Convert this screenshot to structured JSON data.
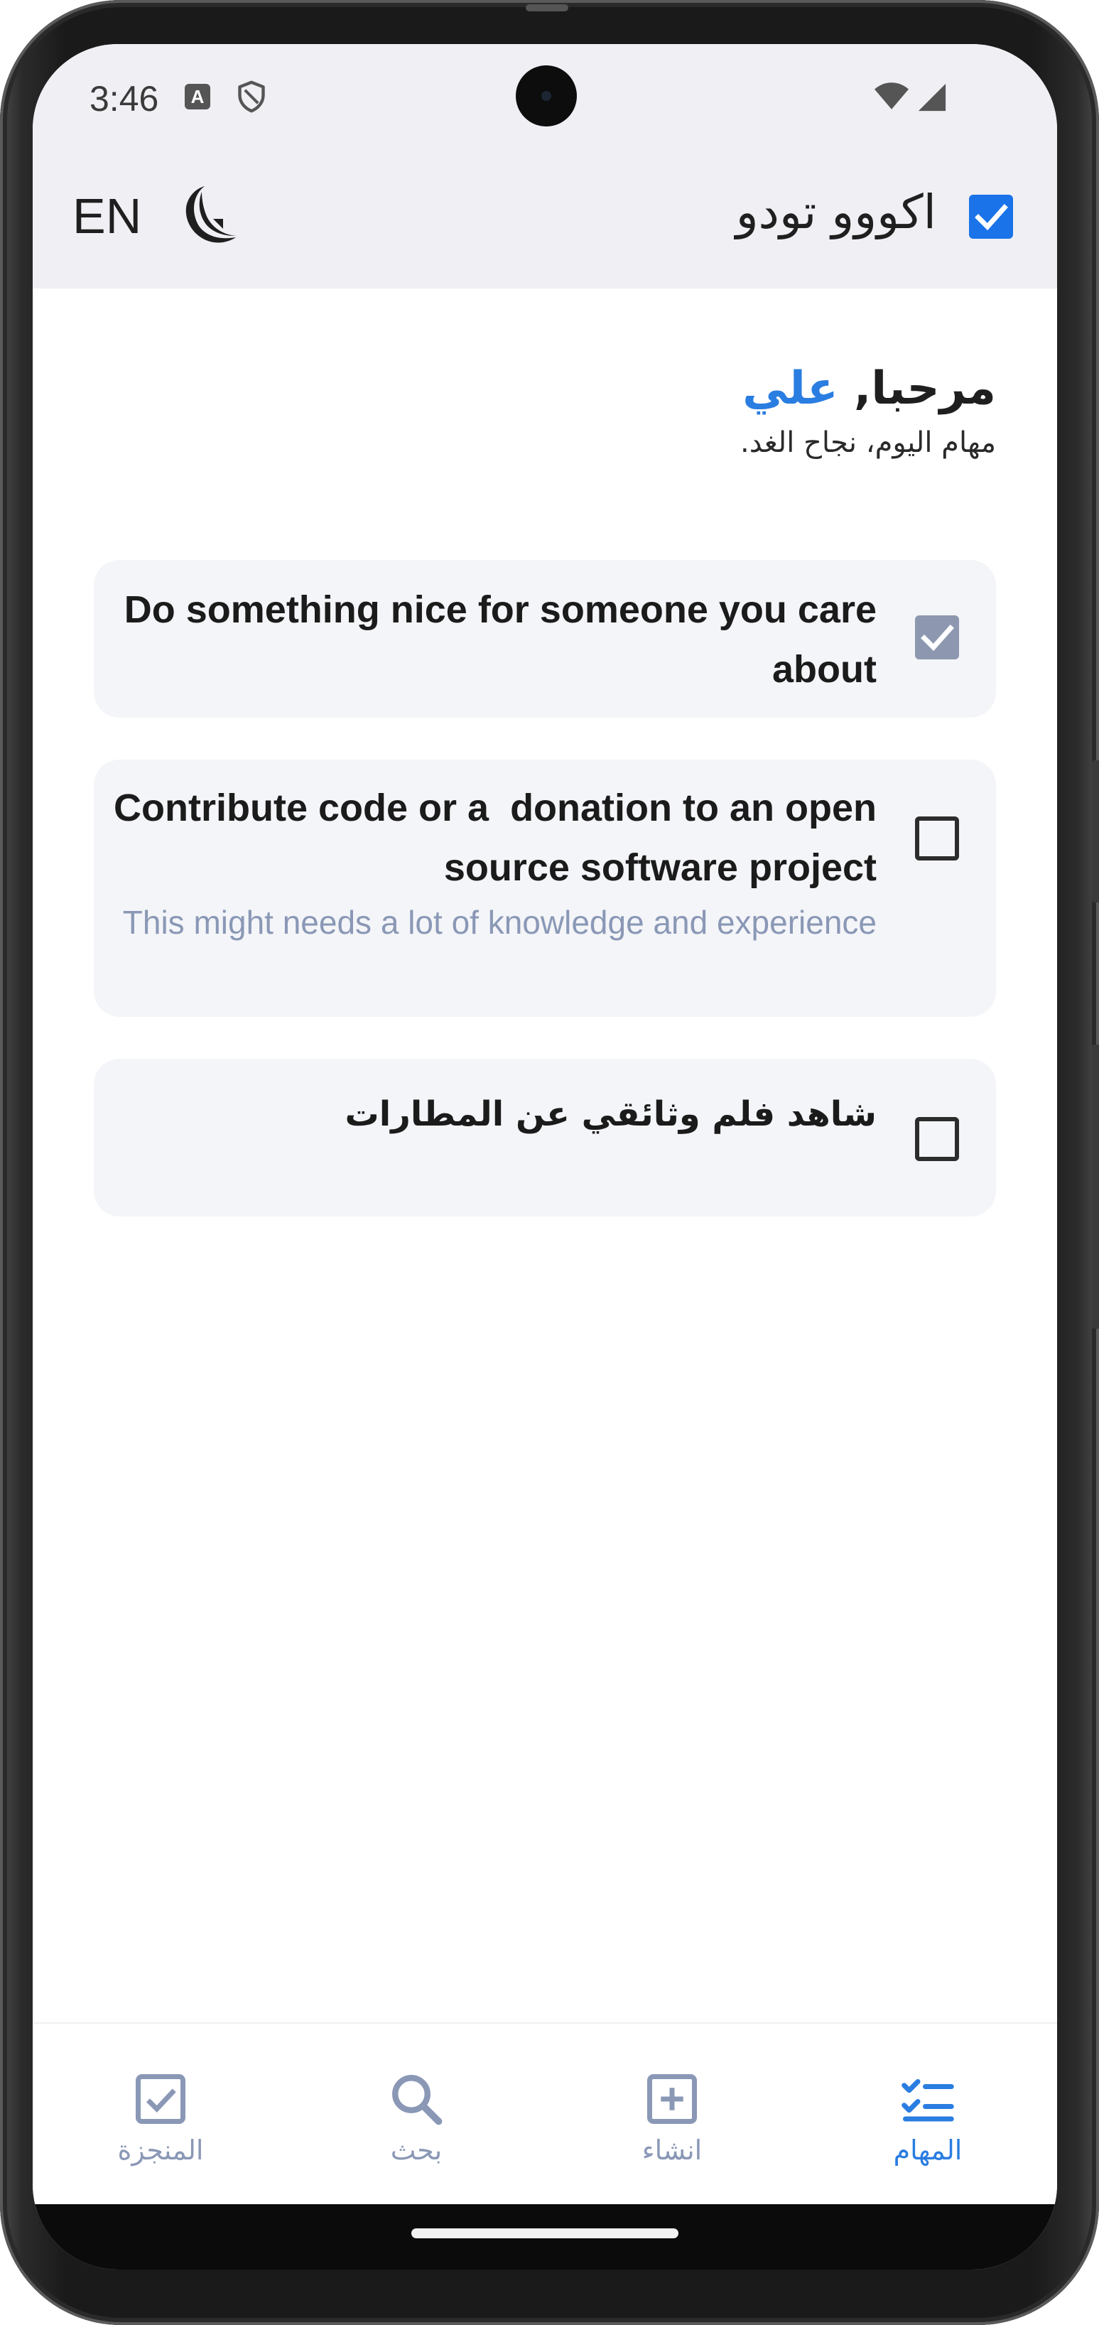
{
  "status_bar": {
    "time": "3:46",
    "keyboard_badge": "A",
    "icons": [
      "keyboard-a-icon",
      "shield-icon",
      "wifi-icon",
      "signal-icon"
    ]
  },
  "app_bar": {
    "title": "اكووو تودو",
    "language_toggle": "EN",
    "theme_icon": "moon-icon",
    "logo_icon": "checkbox-logo-icon"
  },
  "greeting": {
    "hello": "مرحبا",
    "comma": ",",
    "name": "علي",
    "subtitle": "مهام اليوم، نجاح الغد."
  },
  "tasks": [
    {
      "title": "Do something nice for someone you care about",
      "description": "",
      "completed": true
    },
    {
      "title": "Contribute code or a  donation to an open source software project",
      "description": "This might needs a lot of knowledge and experience",
      "completed": false
    },
    {
      "title": "شاهد فلم وثائقي عن المطارات",
      "description": "",
      "completed": false
    }
  ],
  "bottom_nav": {
    "items": [
      {
        "label": "المنجزة",
        "icon": "checkbox-icon",
        "active": false
      },
      {
        "label": "بحث",
        "icon": "search-icon",
        "active": false
      },
      {
        "label": "انشاء",
        "icon": "add-box-icon",
        "active": false
      },
      {
        "label": "المهام",
        "icon": "checklist-icon",
        "active": true
      }
    ]
  },
  "colors": {
    "accent": "#2a7de1",
    "logo_blue": "#1a73e8",
    "muted": "#8a98b6",
    "bar_background": "#efeff4",
    "card_background": "#f4f5f8",
    "checked_box": "#8d98b0"
  }
}
